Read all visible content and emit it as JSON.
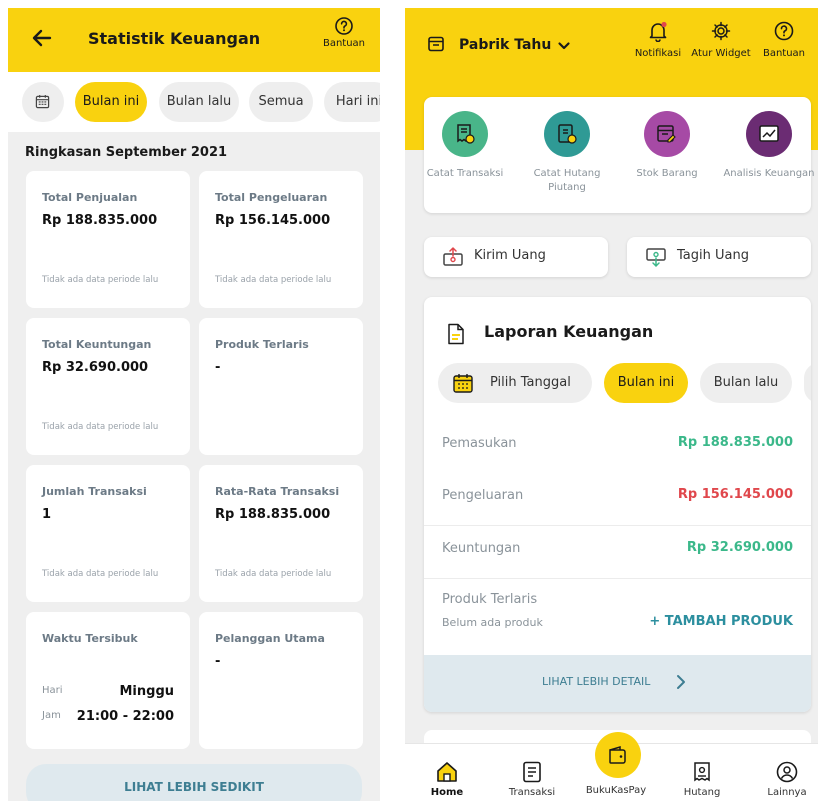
{
  "left": {
    "header": {
      "title": "Statistik Keuangan",
      "help_label": "Bantuan"
    },
    "filters": [
      "Bulan ini",
      "Bulan lalu",
      "Semua",
      "Hari ini"
    ],
    "active_filter": "Bulan ini",
    "section_title": "Ringkasan September 2021",
    "cards": {
      "penjualan": {
        "label": "Total Penjualan",
        "value": "Rp 188.835.000",
        "note": "Tidak ada data periode lalu"
      },
      "pengeluaran": {
        "label": "Total Pengeluaran",
        "value": "Rp 156.145.000",
        "note": "Tidak ada data periode lalu"
      },
      "keuntungan": {
        "label": "Total Keuntungan",
        "value": "Rp 32.690.000",
        "note": "Tidak ada data periode lalu"
      },
      "produk": {
        "label": "Produk Terlaris",
        "value": "-"
      },
      "jumlah": {
        "label": "Jumlah Transaksi",
        "value": "1",
        "note": "Tidak ada data periode lalu"
      },
      "rata": {
        "label": "Rata-Rata Transaksi",
        "value": "Rp 188.835.000",
        "note": "Tidak ada data periode lalu"
      },
      "waktu": {
        "label": "Waktu Tersibuk",
        "hari_key": "Hari",
        "hari_val": "Minggu",
        "jam_key": "Jam",
        "jam_val": "21:00 - 22:00"
      },
      "pelanggan": {
        "label": "Pelanggan Utama",
        "value": "-"
      }
    },
    "more_button": "LIHAT LEBIH SEDIKIT"
  },
  "right": {
    "store_name": "Pabrik Tahu",
    "actions": {
      "notif": "Notifikasi",
      "widget": "Atur Widget",
      "help": "Bantuan"
    },
    "shortcuts": [
      {
        "label": "Catat Transaksi",
        "color": "#49b589"
      },
      {
        "label": "Catat Hutang Piutang",
        "color": "#2f9a95"
      },
      {
        "label": "Stok Barang",
        "color": "#a64aa5"
      },
      {
        "label": "Analisis Keuangan",
        "color": "#6b2c73"
      }
    ],
    "kirim": "Kirim Uang",
    "tagih": "Tagih Uang",
    "report": {
      "title": "Laporan Keuangan",
      "chips": {
        "pilih": "Pilih Tanggal",
        "bulan_ini": "Bulan ini",
        "bulan_lalu": "Bulan lalu"
      },
      "rows": {
        "pemasukan": {
          "label": "Pemasukan",
          "value": "Rp 188.835.000",
          "color": "#3bb88a"
        },
        "pengeluaran": {
          "label": "Pengeluaran",
          "value": "Rp 156.145.000",
          "color": "#e0474c"
        },
        "keuntungan": {
          "label": "Keuntungan",
          "value": "Rp 32.690.000",
          "color": "#3bb88a"
        }
      },
      "produk_label": "Produk Terlaris",
      "produk_sub": "Belum ada produk",
      "produk_add": "+ TAMBAH PRODUK",
      "more": "LIHAT LEBIH DETAIL"
    },
    "nav": {
      "home": "Home",
      "transaksi": "Transaksi",
      "pay": "BukuKasPay",
      "hutang": "Hutang",
      "lainnya": "Lainnya"
    },
    "accent": "#f9d20f"
  }
}
